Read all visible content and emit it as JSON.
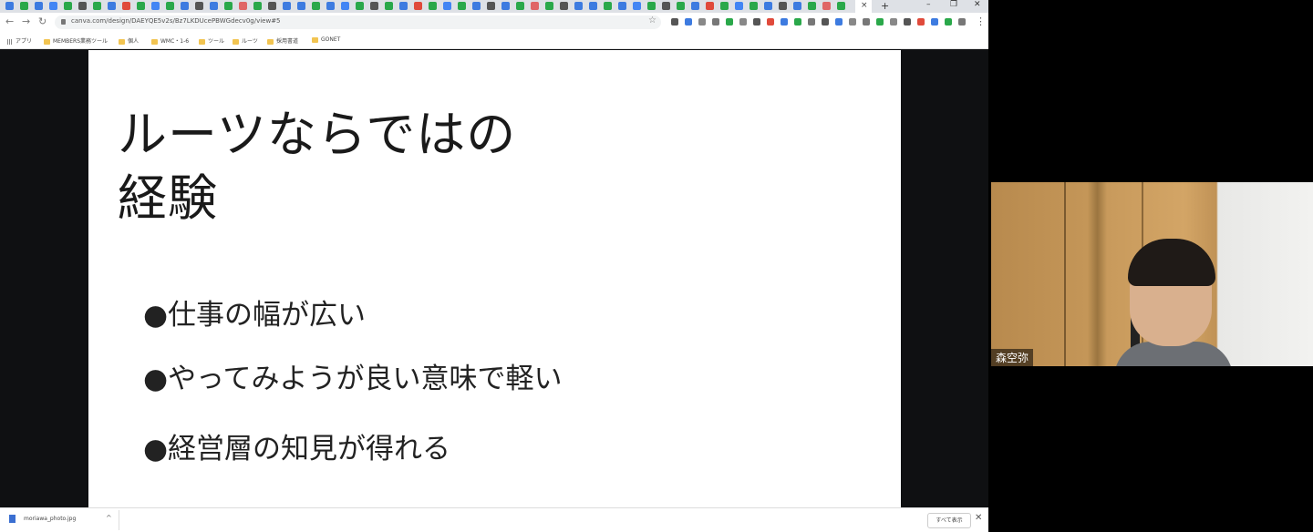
{
  "browser": {
    "url": "canva.com/design/DAEYQE5v2s/Bz7LKDUcePBWGdecv0g/view#5",
    "new_tab": "+",
    "active_tab_close": "×",
    "window_controls": {
      "minimize": "–",
      "restore": "❐",
      "close": "✕"
    },
    "nav": {
      "back": "←",
      "forward": "→",
      "reload": "↻"
    },
    "star": "☆",
    "menu": "⋮",
    "tab_icon_colors": [
      "#3d7be0",
      "#2aa84a",
      "#3d7be0",
      "#4285f4",
      "#2aa84a",
      "#555",
      "#2aa84a",
      "#3d7be0",
      "#e04a3b",
      "#2aa84a",
      "#4285f4",
      "#2aa84a",
      "#3d7be0",
      "#555",
      "#3d7be0",
      "#2aa84a",
      "#e06666",
      "#2aa84a",
      "#555",
      "#3d7be0"
    ],
    "extension_colors": [
      "#555",
      "#3d7be0",
      "#888",
      "#777",
      "#2aa84a",
      "#888",
      "#555",
      "#e04a3b",
      "#3d7be0",
      "#2aa84a",
      "#777"
    ]
  },
  "bookmarks": [
    {
      "label": "アプリ",
      "type": "apps"
    },
    {
      "label": "MEMBERS業務ツール",
      "type": "folder"
    },
    {
      "label": "個人",
      "type": "folder"
    },
    {
      "label": "WMC・1-6",
      "type": "folder"
    },
    {
      "label": "ツール",
      "type": "folder"
    },
    {
      "label": "ルーツ",
      "type": "folder"
    },
    {
      "label": "採用書道",
      "type": "folder"
    },
    {
      "label": "GONET",
      "type": "folder"
    }
  ],
  "slide": {
    "title_line1": "ルーツならではの",
    "title_line2": "経験",
    "bullets": [
      "●仕事の幅が広い",
      "●やってみようが良い意味で軽い",
      "●経営層の知見が得れる"
    ]
  },
  "download_bar": {
    "file_name": "moriawa_photo.jpg",
    "chevron": "^",
    "show_all": "すべて表示",
    "close": "✕"
  },
  "video": {
    "participant_name": "森空弥"
  }
}
